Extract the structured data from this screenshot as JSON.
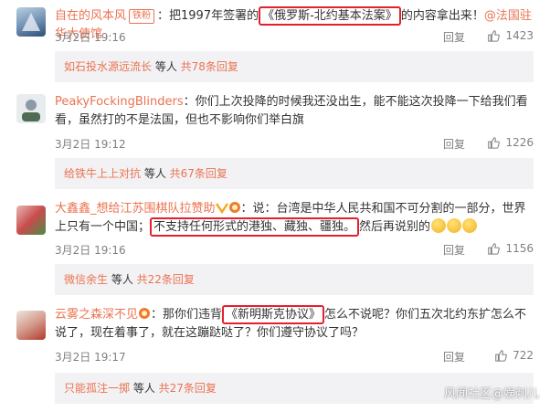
{
  "comments": [
    {
      "name": "自在的风本风",
      "badge": "铁粉",
      "text_before": "：把1997年签署的",
      "highlight": "《俄罗斯-北约基本法案》",
      "text_after": "的内容拿出来！",
      "mention": "@法国驻华大使馆",
      "time": "3月2日 19:16",
      "reply": "回复",
      "likes": "1423",
      "more_who": "如石投水源远流长",
      "more_mid": " 等人 ",
      "more_total": "共78条回复"
    },
    {
      "name": "PeakyFockingBlinders",
      "text": "：你们上次投降的时候我还没出生，能不能这次投降一下给我们看看，虽然打的不是法国，但也不影响你们举白旗",
      "time": "3月2日 19:12",
      "reply": "回复",
      "likes": "1226",
      "more_who": "给铁牛上上对抗",
      "more_mid": " 等人 ",
      "more_total": "共67条回复"
    },
    {
      "name": "大鑫鑫_想给江苏围棋队拉赞助",
      "text_before": "：说：台湾是中华人民共和国不可分割的一部分，世界上只有一个中国；",
      "highlight": "不支持任何形式的港独、藏独、疆独。",
      "text_after": "然后再说别的",
      "time": "3月2日 19:16",
      "reply": "回复",
      "likes": "1156",
      "more_who": "微信余生",
      "more_mid": " 等人 ",
      "more_total": "共22条回复"
    },
    {
      "name": "云雾之森深不见",
      "text_before": "：那你们违背",
      "highlight": "《新明斯克协议》",
      "text_after": "怎么不说呢？你们五次北约东扩怎么不说了，现在着事了，就在这蹦跶哒了？你们遵守协议了吗？",
      "time": "3月2日 19:17",
      "reply": "回复",
      "likes": "722",
      "more_who": "只能孤注一掷",
      "more_mid": " 等人 ",
      "more_total": "共27条回复"
    }
  ],
  "watermark": "风闻社区@娱刺儿",
  "colors": {
    "name": "#eb7350",
    "highlight_border": "#e4202e",
    "more_bg": "#f2f2f5"
  }
}
